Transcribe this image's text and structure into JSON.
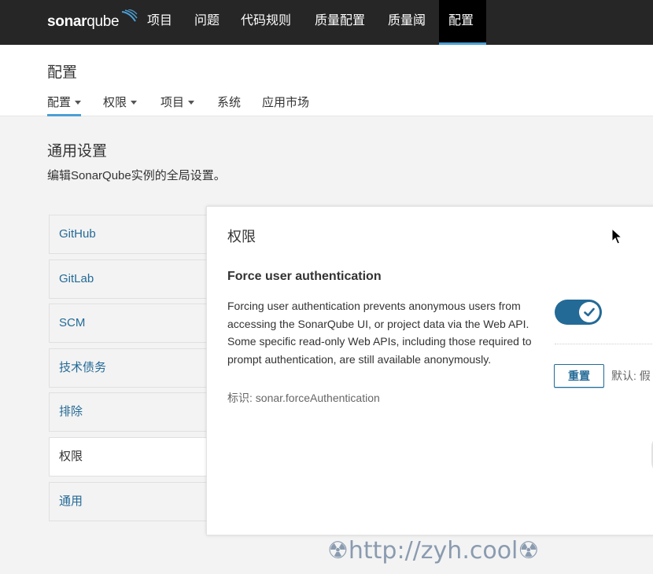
{
  "app": {
    "logo_bold": "sonar",
    "logo_light": "qube"
  },
  "topnav": {
    "items": [
      "项目",
      "问题",
      "代码规则",
      "质量配置",
      "质量阈",
      "配置"
    ],
    "active": "配置"
  },
  "page": {
    "title": "配置",
    "subnav": [
      {
        "label": "配置",
        "has_caret": true
      },
      {
        "label": "权限",
        "has_caret": true
      },
      {
        "label": "项目",
        "has_caret": true
      },
      {
        "label": "系统",
        "has_caret": false
      },
      {
        "label": "应用市场",
        "has_caret": false
      }
    ]
  },
  "section": {
    "title": "通用设置",
    "description": "编辑SonarQube实例的全局设置。"
  },
  "categories": [
    "GitHub",
    "GitLab",
    "SCM",
    "技术债务",
    "排除",
    "权限",
    "通用"
  ],
  "panel": {
    "title": "权限",
    "setting": {
      "name": "Force user authentication",
      "description": "Forcing user authentication prevents anonymous users from accessing the SonarQube UI, or project data via the Web API. Some specific read-only Web APIs, including those required to prompt authentication, are still available anonymously.",
      "key": "标识: sonar.forceAuthentication",
      "enabled": true,
      "reset_label": "重置",
      "default_label": "默认: 假"
    }
  },
  "watermark": "☢http://zyh.cool☢",
  "colors": {
    "topbar": "#262626",
    "accent": "#4b9fd5",
    "link": "#236a97"
  }
}
